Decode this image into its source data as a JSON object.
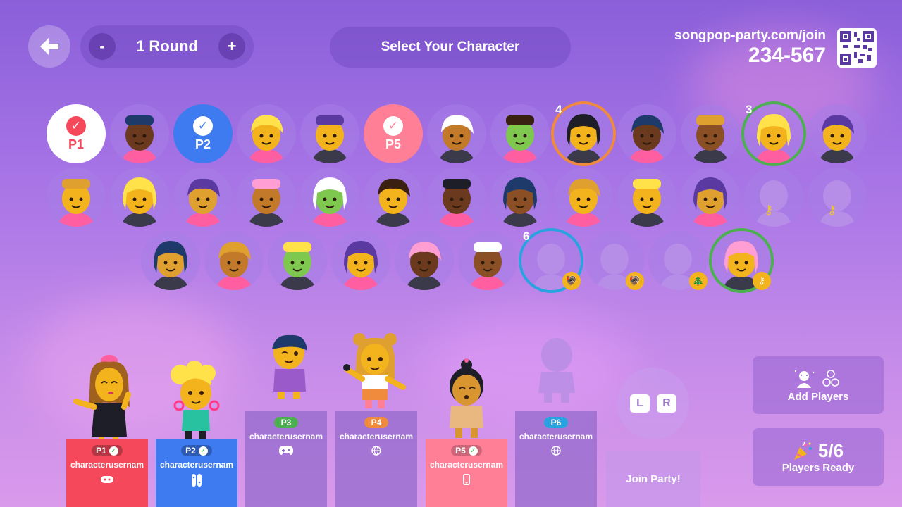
{
  "header": {
    "round_minus": "-",
    "round_label": "1 Round",
    "round_plus": "+",
    "title": "Select Your Character",
    "join_url": "songpop-party.com/join",
    "join_code": "234-567"
  },
  "colors": {
    "p1": "#f5495b",
    "p2": "#3e7bf0",
    "p3": "#4caf50",
    "p4": "#f08a3c",
    "p5": "#ff7f97",
    "p6": "#29a3e0"
  },
  "avatars": {
    "row1_selected": [
      {
        "label": "P1"
      },
      {
        "label": "P2"
      },
      {
        "label": "P5"
      }
    ],
    "hover_numbers": [
      "4",
      "3",
      "6"
    ]
  },
  "players": [
    {
      "tag": "P1",
      "username": "characterusernam",
      "device": "controller-icon",
      "ready": true
    },
    {
      "tag": "P2",
      "username": "characterusernam",
      "device": "switch-icon",
      "ready": true
    },
    {
      "tag": "P3",
      "username": "characterusernam",
      "device": "gamepad-icon",
      "ready": false
    },
    {
      "tag": "P4",
      "username": "characterusernam",
      "device": "web-icon",
      "ready": false
    },
    {
      "tag": "P5",
      "username": "characterusernam",
      "device": "phone-icon",
      "ready": true
    },
    {
      "tag": "P6",
      "username": "characterusernam",
      "device": "web-icon",
      "ready": false
    }
  ],
  "controls": {
    "l_key": "L",
    "r_key": "R",
    "join_party": "Join Party!",
    "add_players": "Add Players",
    "ready_count": "5/6",
    "players_ready": "Players Ready"
  }
}
